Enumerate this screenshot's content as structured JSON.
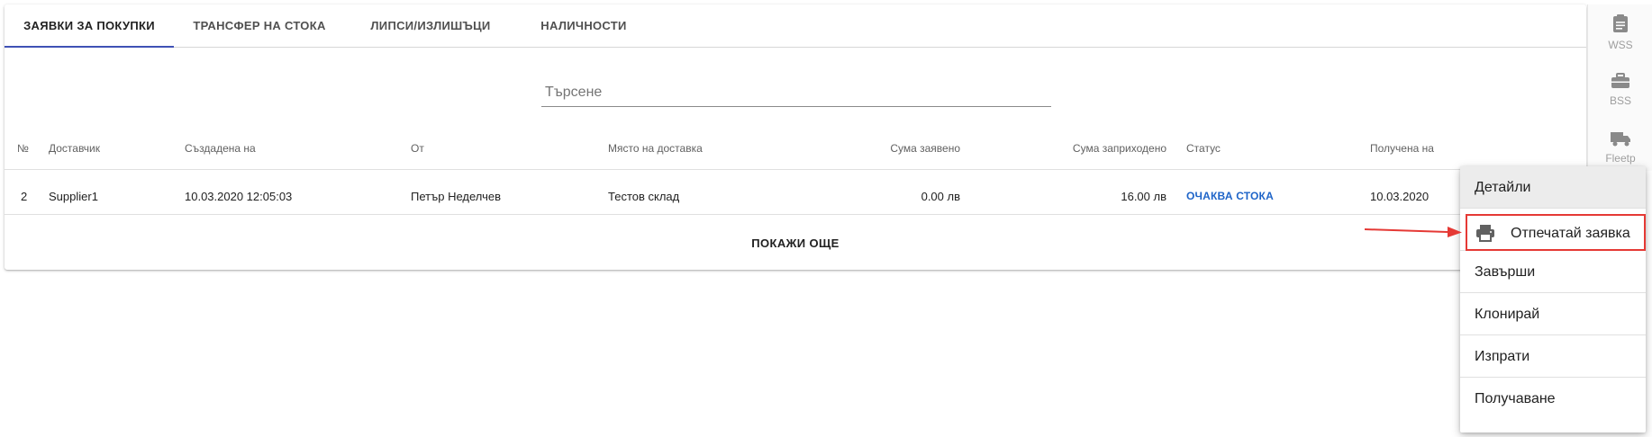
{
  "tabs": [
    {
      "label": "ЗАЯВКИ ЗА ПОКУПКИ",
      "active": true
    },
    {
      "label": "ТРАНСФЕР НА СТОКА"
    },
    {
      "label": "ЛИПСИ/ИЗЛИШЪЦИ"
    },
    {
      "label": "НАЛИЧНОСТИ"
    }
  ],
  "search": {
    "placeholder": "Търсене",
    "value": ""
  },
  "table": {
    "columns": [
      "№",
      "Доставчик",
      "Създадена на",
      "От",
      "Място на доставка",
      "Сума заявено",
      "Сума заприходено",
      "Статус",
      "Получена на"
    ],
    "rows": [
      {
        "number": "2",
        "supplier": "Supplier1",
        "created": "10.03.2020 12:05:03",
        "from": "Петър Неделчев",
        "location": "Тестов склад",
        "amount_ordered": "0.00 лв",
        "amount_received": "16.00 лв",
        "status": "ОЧАКВА СТОКА",
        "received_on": "10.03.2020"
      }
    ],
    "show_more": "ПОКАЖИ ОЩЕ"
  },
  "rail": [
    {
      "label": "WSS",
      "icon": "clipboard-icon"
    },
    {
      "label": "BSS",
      "icon": "briefcase-icon"
    },
    {
      "label": "Fleetp",
      "icon": "truck-icon"
    }
  ],
  "menu": {
    "items": [
      "Детайли",
      "Отпечатай заявка",
      "Завърши",
      "Клонирай",
      "Изпрати",
      "Получаване"
    ],
    "highlighted_icon": "printer-icon"
  },
  "colors": {
    "accent": "#3f51b5",
    "status": "#1e64c8",
    "highlight": "#e53935"
  }
}
